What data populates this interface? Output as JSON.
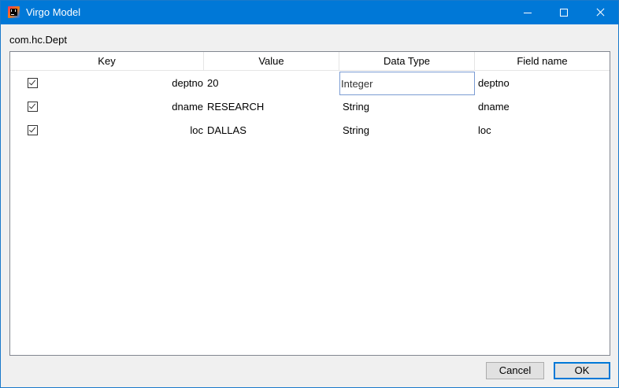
{
  "window": {
    "title": "Virgo Model",
    "accent_color": "#0078d7"
  },
  "class_name": "com.hc.Dept",
  "table": {
    "columns": [
      "Key",
      "Value",
      "Data Type",
      "Field name"
    ],
    "rows": [
      {
        "checked": true,
        "key": "deptno",
        "value": "20",
        "data_type": "Integer",
        "field_name": "deptno"
      },
      {
        "checked": true,
        "key": "dname",
        "value": "RESEARCH",
        "data_type": "String",
        "field_name": "dname"
      },
      {
        "checked": true,
        "key": "loc",
        "value": "DALLAS",
        "data_type": "String",
        "field_name": "loc"
      }
    ]
  },
  "buttons": {
    "cancel": "Cancel",
    "ok": "OK"
  },
  "icons": {
    "app": "intellij-app-icon",
    "minimize": "minimize-icon",
    "maximize": "maximize-icon",
    "close": "close-icon",
    "checkbox": "checkmark-icon"
  }
}
